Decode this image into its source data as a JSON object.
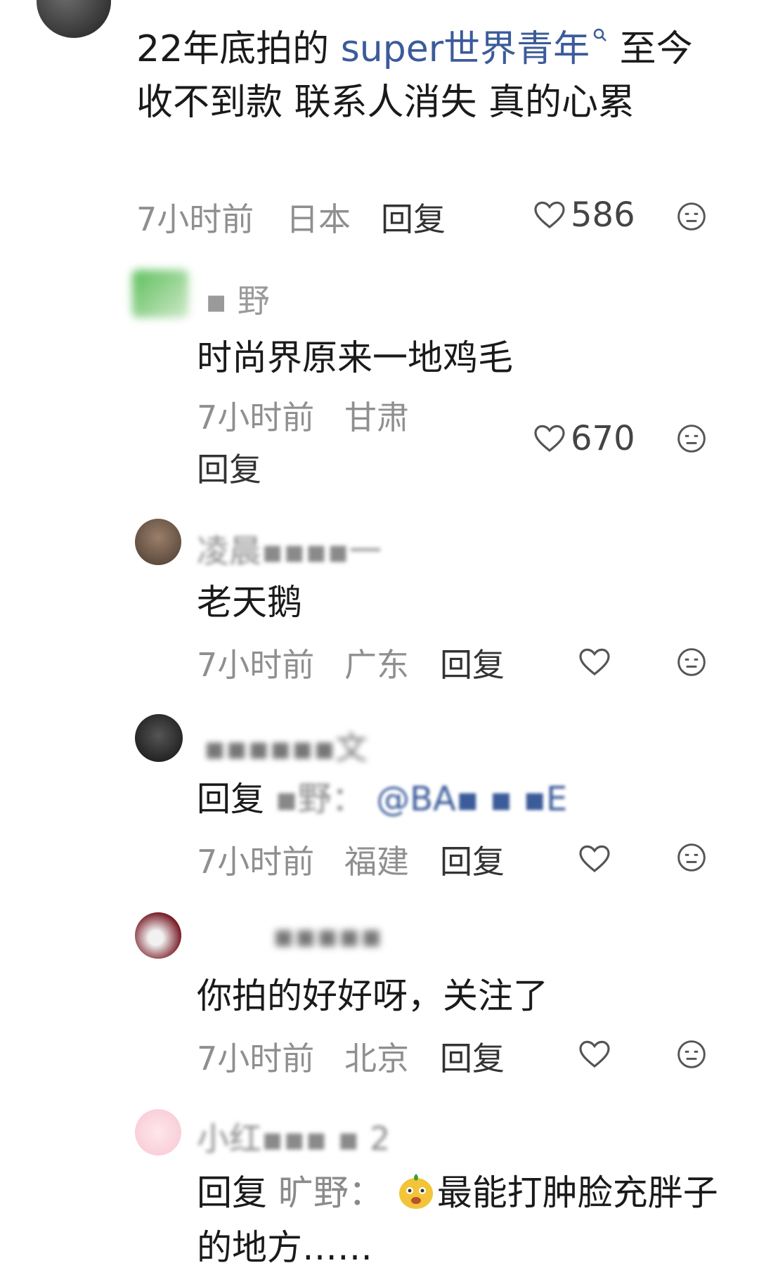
{
  "comments": [
    {
      "text_prefix": "22年底拍的 ",
      "link": "super世界青年",
      "text_suffix": " 至今收不到款 联系人消失 真的心累",
      "time": "7小时前",
      "location": "日本",
      "reply": "回复",
      "likes": "586"
    },
    {
      "username": "▪ 野",
      "text": "时尚界原来一地鸡毛",
      "time": "7小时前",
      "location": "甘肃",
      "reply": "回复",
      "likes": "670"
    },
    {
      "username": "凌晨▪▪▪▪一",
      "text": "老天鹅",
      "time": "7小时前",
      "location": "广东",
      "reply": "回复",
      "likes": ""
    },
    {
      "username": "▪▪▪▪▪▪文",
      "reply_prefix": "回复",
      "reply_to": " ▪野：",
      "mention": "@BA▪ ▪ ▪E",
      "time": "7小时前",
      "location": "福建",
      "reply": "回复",
      "likes": ""
    },
    {
      "username": "▪▪▪▪▪",
      "text": "你拍的好好呀，关注了",
      "time": "7小时前",
      "location": "北京",
      "reply": "回复",
      "likes": ""
    },
    {
      "username": "小红▪▪▪ ▪ 2",
      "reply_prefix": "回复",
      "reply_to": " 旷野：",
      "text": "最能打肿脸充胖子的地方……",
      "time": "",
      "location": "",
      "reply": "",
      "likes": ""
    }
  ],
  "icons": {
    "like": "heart-outline-icon",
    "dislike": "meh-face-icon",
    "search": "search-icon"
  }
}
